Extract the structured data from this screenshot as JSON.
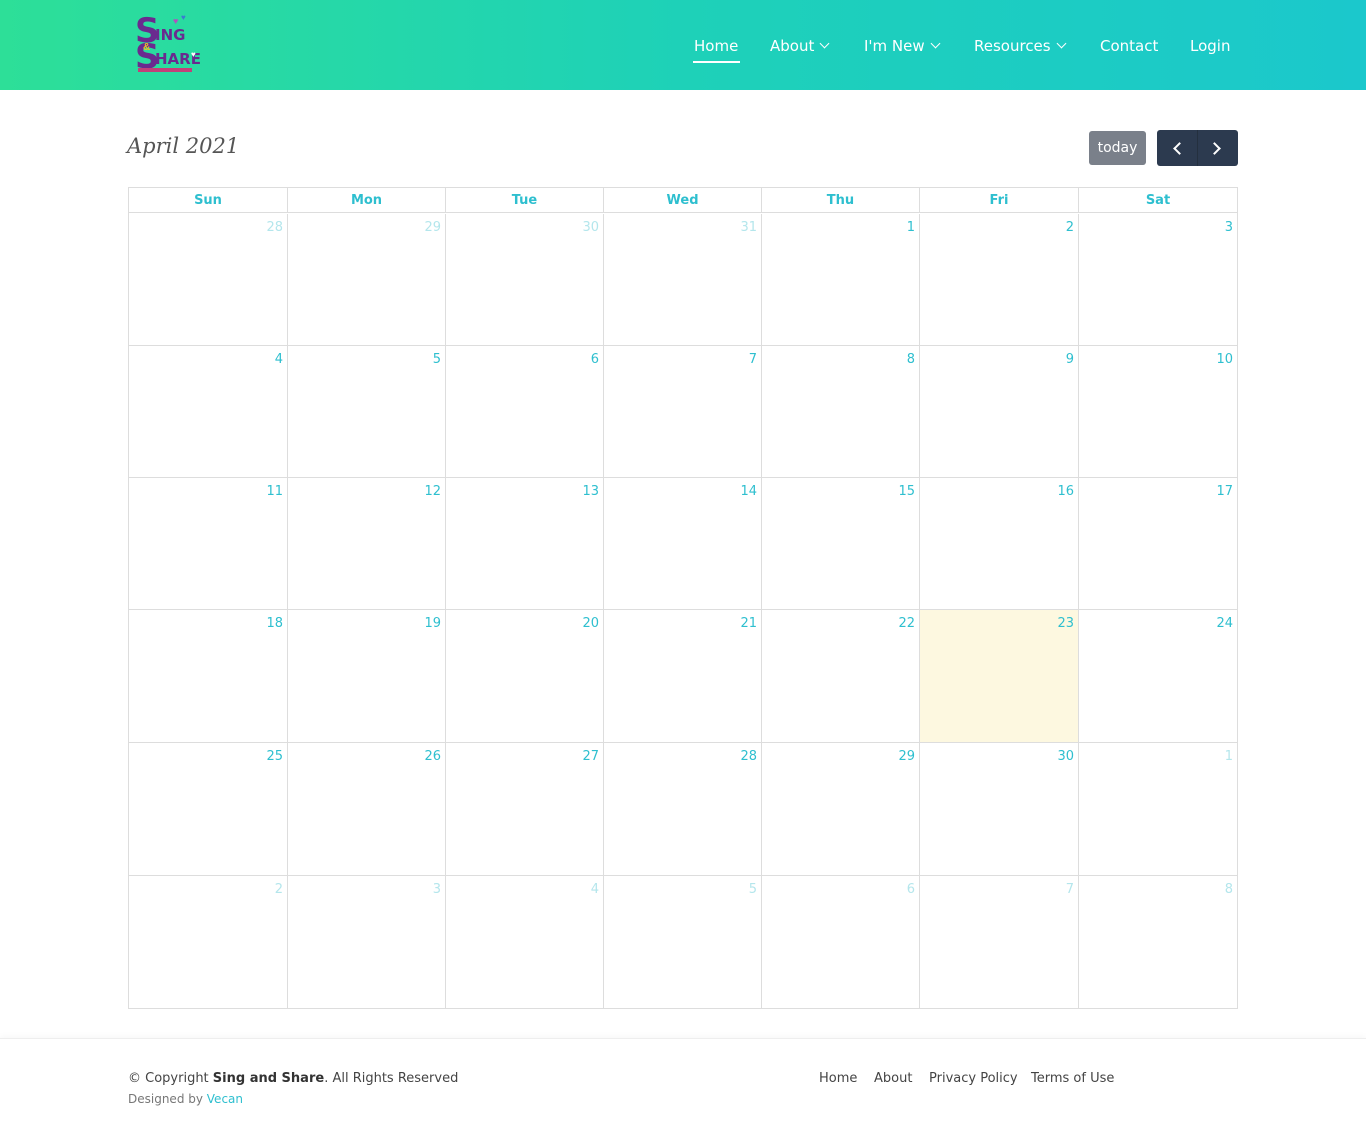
{
  "brand": {
    "logo_line1": "S",
    "logo_ing": "ING",
    "logo_line2": "S",
    "logo_hare": "HARE"
  },
  "nav": {
    "home": "Home",
    "about": "About",
    "im_new": "I'm New",
    "resources": "Resources",
    "contact": "Contact",
    "login": "Login"
  },
  "calendar": {
    "title": "April 2021",
    "today_label": "today",
    "weekdays": [
      "Sun",
      "Mon",
      "Tue",
      "Wed",
      "Thu",
      "Fri",
      "Sat"
    ],
    "weeks": [
      [
        "28",
        "29",
        "30",
        "31",
        "1",
        "2",
        "3"
      ],
      [
        "4",
        "5",
        "6",
        "7",
        "8",
        "9",
        "10"
      ],
      [
        "11",
        "12",
        "13",
        "14",
        "15",
        "16",
        "17"
      ],
      [
        "18",
        "19",
        "20",
        "21",
        "22",
        "23",
        "24"
      ],
      [
        "25",
        "26",
        "27",
        "28",
        "29",
        "30",
        "1"
      ],
      [
        "2",
        "3",
        "4",
        "5",
        "6",
        "7",
        "8"
      ]
    ],
    "other_month": [
      [
        true,
        true,
        true,
        true,
        false,
        false,
        false
      ],
      [
        false,
        false,
        false,
        false,
        false,
        false,
        false
      ],
      [
        false,
        false,
        false,
        false,
        false,
        false,
        false
      ],
      [
        false,
        false,
        false,
        false,
        false,
        false,
        false
      ],
      [
        false,
        false,
        false,
        false,
        false,
        false,
        true
      ],
      [
        true,
        true,
        true,
        true,
        true,
        true,
        true
      ]
    ],
    "today_date": "23",
    "colors": {
      "accent": "#2ebfcf",
      "today_bg": "#fdf8e0",
      "nav_button": "#2c3a4f",
      "today_button": "#7a808a"
    }
  },
  "footer": {
    "copyright_prefix": "© Copyright ",
    "copyright_brand": "Sing and Share",
    "copyright_suffix": ". All Rights Reserved",
    "designed_by": "Designed by ",
    "designer": "Vecan",
    "links": {
      "home": "Home",
      "about": "About",
      "privacy": "Privacy Policy",
      "terms": "Terms of Use"
    }
  }
}
